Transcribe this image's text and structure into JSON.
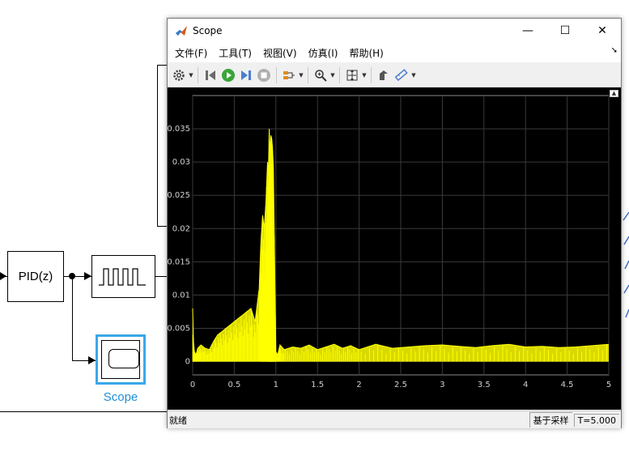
{
  "diagram": {
    "pid_label": "PID(z)",
    "scope_label": "Scope"
  },
  "window": {
    "title": "Scope",
    "controls": {
      "minimize": "—",
      "maximize": "☐",
      "close": "✕"
    },
    "menu": [
      "文件(F)",
      "工具(T)",
      "视图(V)",
      "仿真(I)",
      "帮助(H)"
    ],
    "toolbar_icons": [
      "gear-icon",
      "step-back-icon",
      "run-icon",
      "step-forward-icon",
      "stop-icon",
      "signal-icon",
      "zoom-icon",
      "fit-icon",
      "cursor-icon",
      "measure-icon"
    ],
    "status": {
      "left": "就绪",
      "mode": "基于采样",
      "time": "T=5.000"
    },
    "colors": {
      "plot_bg": "#000000",
      "signal": "#ffff00",
      "grid": "#3a3a3a"
    }
  },
  "chart_data": {
    "type": "line",
    "xlim": [
      0,
      5
    ],
    "ylim": [
      -0.002,
      0.04
    ],
    "xticks": [
      "0",
      "0.5",
      "1",
      "1.5",
      "2",
      "2.5",
      "3",
      "3.5",
      "4",
      "4.5",
      "5"
    ],
    "yticks": [
      "0",
      "0.005",
      "0.01",
      "0.015",
      "0.02",
      "0.025",
      "0.03",
      "0.035"
    ],
    "grid": true,
    "series": [
      {
        "color": "#ffff00",
        "x": [
          0,
          0.01,
          0.02,
          0.04,
          0.06,
          0.1,
          0.15,
          0.2,
          0.25,
          0.3,
          0.35,
          0.4,
          0.45,
          0.5,
          0.55,
          0.6,
          0.65,
          0.7,
          0.75,
          0.8,
          0.82,
          0.84,
          0.86,
          0.88,
          0.9,
          0.91,
          0.92,
          0.93,
          0.94,
          0.95,
          0.96,
          0.97,
          0.98,
          0.99,
          1.0,
          1.02,
          1.05,
          1.1,
          1.2,
          1.3,
          1.4,
          1.5,
          1.6,
          1.7,
          1.8,
          1.9,
          2.0,
          2.2,
          2.4,
          2.6,
          2.8,
          3.0,
          3.2,
          3.4,
          3.6,
          3.8,
          4.0,
          4.2,
          4.4,
          4.6,
          4.8,
          5.0
        ],
        "y": [
          0.008,
          0.003,
          0.0015,
          0.001,
          0.002,
          0.0025,
          0.002,
          0.0018,
          0.003,
          0.004,
          0.0045,
          0.005,
          0.0055,
          0.006,
          0.0065,
          0.007,
          0.0075,
          0.008,
          0.006,
          0.011,
          0.018,
          0.022,
          0.02,
          0.024,
          0.03,
          0.028,
          0.035,
          0.031,
          0.034,
          0.0335,
          0.032,
          0.029,
          0.02,
          0.01,
          0.0015,
          0.001,
          0.0025,
          0.0018,
          0.0022,
          0.002,
          0.0025,
          0.0018,
          0.0022,
          0.0026,
          0.002,
          0.0024,
          0.0018,
          0.0026,
          0.002,
          0.0022,
          0.0024,
          0.0025,
          0.0023,
          0.0021,
          0.0024,
          0.0026,
          0.0022,
          0.0023,
          0.0021,
          0.0022,
          0.0024,
          0.0026
        ]
      }
    ]
  }
}
